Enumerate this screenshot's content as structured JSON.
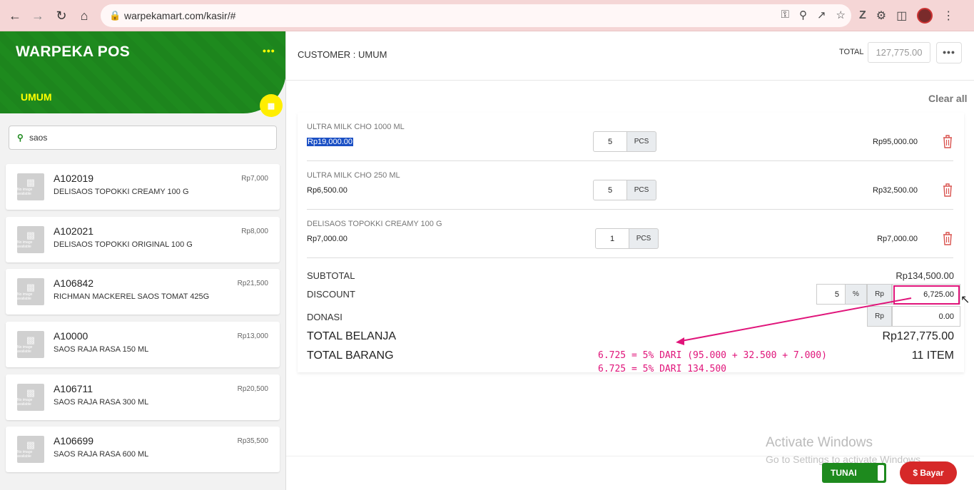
{
  "browser": {
    "url": "warpekamart.com/kasir/#"
  },
  "sidebar": {
    "app_title": "WARPEKA POS",
    "more": "•••",
    "customer": "UMUM",
    "search_value": "saos",
    "no_image_text": "No image available",
    "products": [
      {
        "code": "A102019",
        "name": "DELISAOS TOPOKKI CREAMY 100 G",
        "price": "Rp7,000"
      },
      {
        "code": "A102021",
        "name": "DELISAOS TOPOKKI ORIGINAL 100 G",
        "price": "Rp8,000"
      },
      {
        "code": "A106842",
        "name": "RICHMAN MACKEREL SAOS TOMAT 425G",
        "price": "Rp21,500"
      },
      {
        "code": "A10000",
        "name": "SAOS RAJA RASA 150 ML",
        "price": "Rp13,000"
      },
      {
        "code": "A106711",
        "name": "SAOS RAJA RASA 300 ML",
        "price": "Rp20,500"
      },
      {
        "code": "A106699",
        "name": "SAOS RAJA RASA 600 ML",
        "price": "Rp35,500"
      }
    ]
  },
  "header": {
    "customer_label": "CUSTOMER : UMUM",
    "total_label": "TOTAL",
    "total_value": "127,775.00",
    "more": "•••"
  },
  "cart": {
    "clear_all": "Clear all",
    "items": [
      {
        "name": "ULTRA MILK CHO 1000 ML",
        "price": "Rp19,000.00",
        "qty": "5",
        "unit": "PCS",
        "subtotal": "Rp95,000.00"
      },
      {
        "name": "ULTRA MILK CHO 250 ML",
        "price": "Rp6,500.00",
        "qty": "5",
        "unit": "PCS",
        "subtotal": "Rp32,500.00"
      },
      {
        "name": "DELISAOS TOPOKKI CREAMY 100 G",
        "price": "Rp7,000.00",
        "qty": "1",
        "unit": "PCS",
        "subtotal": "Rp7,000.00"
      }
    ],
    "subtotal_label": "SUBTOTAL",
    "subtotal_value": "Rp134,500.00",
    "discount_label": "DISCOUNT",
    "discount_percent": "5",
    "percent_symbol": "%",
    "rp_symbol": "Rp",
    "discount_amount": "6,725.00",
    "donasi_label": "DONASI",
    "donasi_value": "0.00",
    "total_belanja_label": "TOTAL BELANJA",
    "total_belanja_value": "Rp127,775.00",
    "total_barang_label": "TOTAL BARANG",
    "total_barang_value": "11 ITEM"
  },
  "annotation": {
    "line1": "6.725 = 5% DARI (95.000 + 32.500 + 7.000)",
    "line2": "6.725 = 5% DARI 134.500",
    "color": "#e0147a"
  },
  "footer": {
    "payment_method": "TUNAI",
    "pay_button": "$ Bayar"
  },
  "watermark": {
    "title": "Activate Windows",
    "subtitle": "Go to Settings to activate Windows."
  },
  "colors": {
    "brand_green": "#1e8a1e",
    "accent_yellow": "#ffee00",
    "pay_red": "#d62828"
  }
}
